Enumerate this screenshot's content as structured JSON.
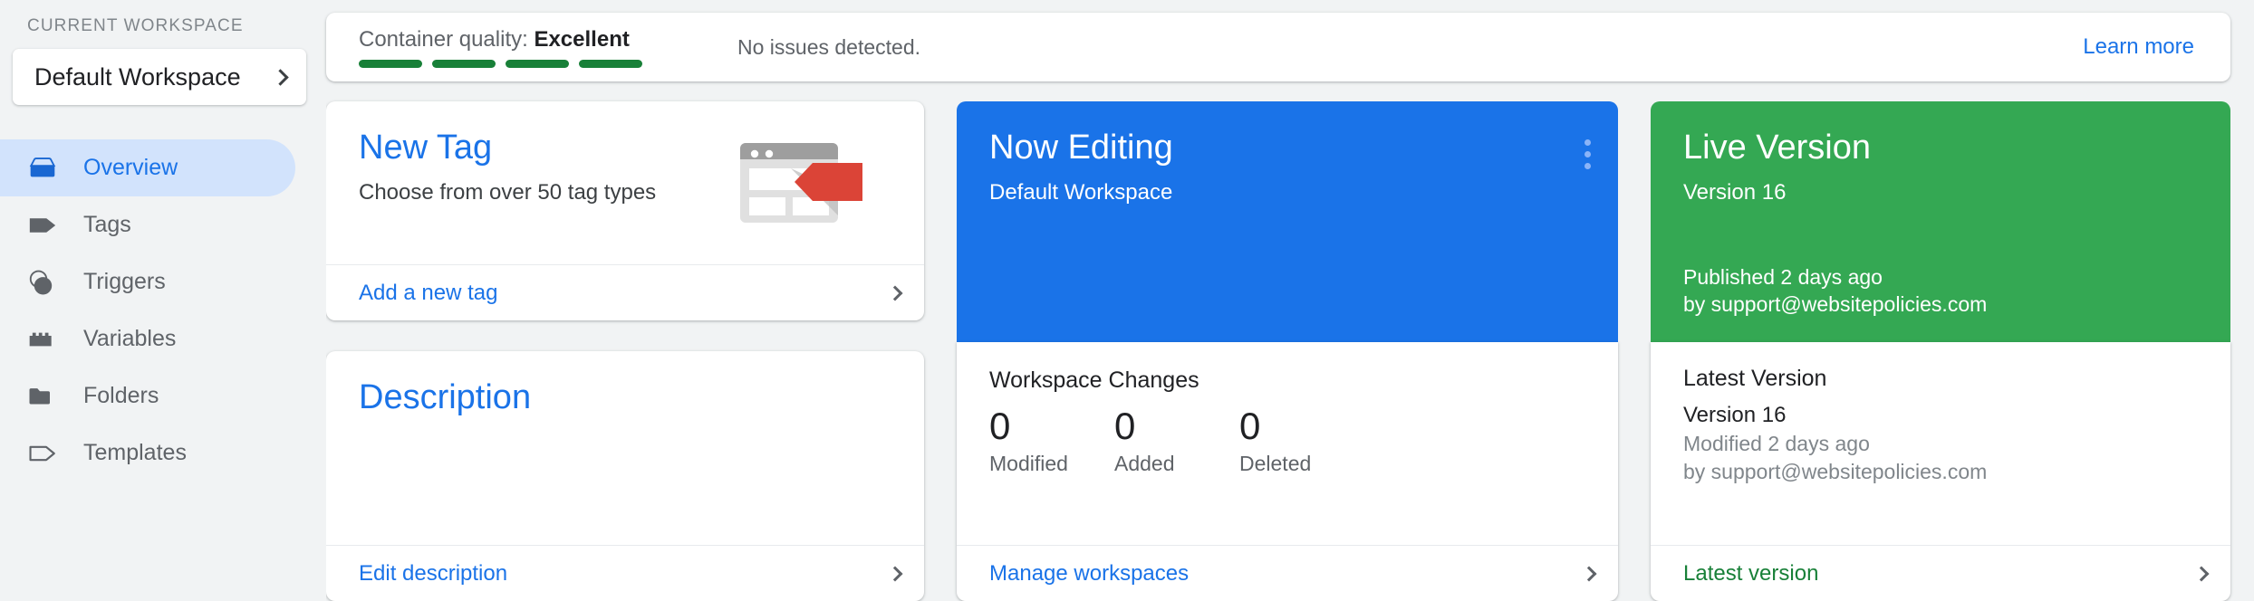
{
  "sidebar": {
    "workspace_label": "CURRENT WORKSPACE",
    "workspace_name": "Default Workspace",
    "items": [
      {
        "label": "Overview",
        "icon": "overview-icon",
        "active": true
      },
      {
        "label": "Tags",
        "icon": "tag-icon",
        "active": false
      },
      {
        "label": "Triggers",
        "icon": "trigger-icon",
        "active": false
      },
      {
        "label": "Variables",
        "icon": "variables-icon",
        "active": false
      },
      {
        "label": "Folders",
        "icon": "folder-icon",
        "active": false
      },
      {
        "label": "Templates",
        "icon": "template-icon",
        "active": false
      }
    ]
  },
  "quality": {
    "label": "Container quality:",
    "value": "Excellent",
    "issues": "No issues detected.",
    "learn_more": "Learn more",
    "bars": 4,
    "bar_color": "#188038"
  },
  "new_tag": {
    "title": "New Tag",
    "subtitle": "Choose from over 50 tag types",
    "footer_link": "Add a new tag"
  },
  "description": {
    "title": "Description",
    "footer_link": "Edit description"
  },
  "now_editing": {
    "title": "Now Editing",
    "subtitle": "Default Workspace",
    "accent": "#1a73e8",
    "changes_title": "Workspace Changes",
    "stats": [
      {
        "value": "0",
        "label": "Modified"
      },
      {
        "value": "0",
        "label": "Added"
      },
      {
        "value": "0",
        "label": "Deleted"
      }
    ],
    "footer_link": "Manage workspaces"
  },
  "live_version": {
    "title": "Live Version",
    "subtitle": "Version 16",
    "accent": "#34a853",
    "published": "Published 2 days ago",
    "published_by": "by support@websitepolicies.com",
    "latest_title": "Latest Version",
    "latest_version": "Version 16",
    "latest_modified": "Modified 2 days ago",
    "latest_by": "by support@websitepolicies.com",
    "footer_link": "Latest version"
  }
}
